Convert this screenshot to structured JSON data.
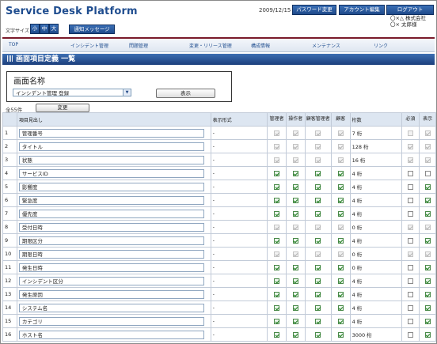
{
  "app": {
    "title": "Service Desk Platform",
    "date": "2009/12/15",
    "header_buttons": [
      "パスワード変更",
      "アカウント編集",
      "ログアウト"
    ],
    "company": "〇×△ 株式会社",
    "user": "〇× 太郎様",
    "font_size_label": "文字サイズ",
    "font_sizes": [
      "小",
      "中",
      "大"
    ],
    "notice_button": "通知メッセージ"
  },
  "nav": [
    "TOP",
    "インシデント管理",
    "問題管理",
    "変更・リリース管理",
    "構成情報",
    "メンテナンス",
    "リンク"
  ],
  "page_title": "画面項目定義 一覧",
  "screen": {
    "heading": "画面名称",
    "selected": "インシデント管理 登録",
    "display_button": "表示"
  },
  "total": "全55件",
  "change_button": "変更",
  "columns": [
    "項目見出し",
    "表示形式",
    "管理者",
    "操作者",
    "顧客管理者",
    "顧客",
    "桁数",
    "必須",
    "表示"
  ],
  "rows": [
    {
      "no": "1",
      "name": "管理番号",
      "format": "-",
      "digits": "7 桁",
      "checks": [
        1,
        1,
        1,
        1,
        0,
        1
      ],
      "disabled": true
    },
    {
      "no": "2",
      "name": "タイトル",
      "format": "-",
      "digits": "128 桁",
      "checks": [
        1,
        1,
        1,
        1,
        1,
        1
      ],
      "disabled": true
    },
    {
      "no": "3",
      "name": "状態",
      "format": "-",
      "digits": "16 桁",
      "checks": [
        1,
        1,
        1,
        1,
        1,
        1
      ],
      "disabled": true
    },
    {
      "no": "4",
      "name": "サービスID",
      "format": "-",
      "digits": "4 桁",
      "checks": [
        1,
        1,
        1,
        1,
        0,
        0
      ],
      "disabled": false
    },
    {
      "no": "5",
      "name": "影響度",
      "format": "-",
      "digits": "4 桁",
      "checks": [
        1,
        1,
        1,
        1,
        0,
        1
      ],
      "disabled": false
    },
    {
      "no": "6",
      "name": "緊急度",
      "format": "-",
      "digits": "4 桁",
      "checks": [
        1,
        1,
        1,
        1,
        0,
        1
      ],
      "disabled": false
    },
    {
      "no": "7",
      "name": "優先度",
      "format": "-",
      "digits": "4 桁",
      "checks": [
        1,
        1,
        1,
        1,
        0,
        1
      ],
      "disabled": false
    },
    {
      "no": "8",
      "name": "受付日時",
      "format": "-",
      "digits": "0 桁",
      "checks": [
        1,
        1,
        1,
        1,
        1,
        1
      ],
      "disabled": true
    },
    {
      "no": "9",
      "name": "期限区分",
      "format": "-",
      "digits": "4 桁",
      "checks": [
        1,
        1,
        1,
        1,
        0,
        1
      ],
      "disabled": false
    },
    {
      "no": "10",
      "name": "期限日時",
      "format": "-",
      "digits": "0 桁",
      "checks": [
        1,
        1,
        1,
        1,
        1,
        1
      ],
      "disabled": true
    },
    {
      "no": "11",
      "name": "発生日時",
      "format": "-",
      "digits": "0 桁",
      "checks": [
        1,
        1,
        1,
        1,
        0,
        1
      ],
      "disabled": false
    },
    {
      "no": "12",
      "name": "インシデント区分",
      "format": "-",
      "digits": "4 桁",
      "checks": [
        1,
        1,
        1,
        1,
        0,
        1
      ],
      "disabled": false
    },
    {
      "no": "13",
      "name": "発生原因",
      "format": "-",
      "digits": "4 桁",
      "checks": [
        1,
        1,
        1,
        1,
        0,
        1
      ],
      "disabled": false
    },
    {
      "no": "14",
      "name": "システム名",
      "format": "-",
      "digits": "4 桁",
      "checks": [
        1,
        1,
        1,
        1,
        0,
        1
      ],
      "disabled": false
    },
    {
      "no": "15",
      "name": "カテゴリ",
      "format": "-",
      "digits": "4 桁",
      "checks": [
        1,
        1,
        1,
        1,
        0,
        1
      ],
      "disabled": false
    },
    {
      "no": "16",
      "name": "ホスト名",
      "format": "-",
      "digits": "3000 桁",
      "checks": [
        1,
        1,
        1,
        1,
        0,
        1
      ],
      "disabled": false
    }
  ]
}
